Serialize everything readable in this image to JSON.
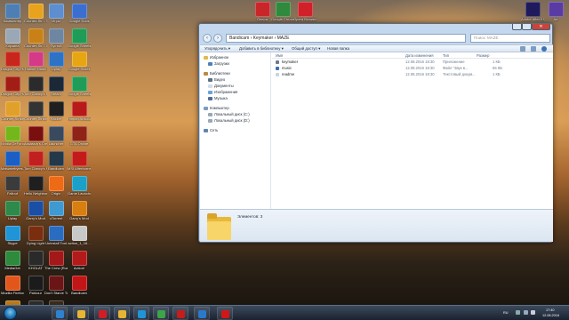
{
  "desktop": {
    "icons": [
      {
        "label": "Компьютер",
        "color": "#4d7fb5"
      },
      {
        "label": "Counter-Str... Source",
        "color": "#e8a21c"
      },
      {
        "label": "Игры",
        "color": "#5c8ed0"
      },
      {
        "label": "Google Docs",
        "color": "#3b6ed1"
      },
      {
        "label": "Корзина",
        "color": "#9aa8b6"
      },
      {
        "label": "Counter-Str... Global Off...",
        "color": "#c98016"
      },
      {
        "label": "Пустой",
        "color": "#6e86a1"
      },
      {
        "label": "Google Sheets",
        "color": "#1f9c57"
      },
      {
        "label": "Dragon City Hack...",
        "color": "#c8261c"
      },
      {
        "label": "Hotline Miami",
        "color": "#d43a86"
      },
      {
        "label": "Uplay",
        "color": "#2d72c5"
      },
      {
        "label": "Google Slides",
        "color": "#e6a511"
      },
      {
        "label": "Dragon City Hack...",
        "color": "#a31d17"
      },
      {
        "label": "Tom Clancy's Ra...",
        "color": "#2b2b2b"
      },
      {
        "label": "Steam",
        "color": "#1b2838"
      },
      {
        "label": "Google Sheets",
        "color": "#1f9c57"
      },
      {
        "label": "Counter-Strike",
        "color": "#e0a02a"
      },
      {
        "label": "Counter-Strike",
        "color": "#333333"
      },
      {
        "label": "Hacker",
        "color": "#1f1f1f"
      },
      {
        "label": "Hitman Absolution",
        "color": "#b81919"
      },
      {
        "label": "Nvidia GeForce Experience",
        "color": "#74b71b"
      },
      {
        "label": "Assassin's Creed",
        "color": "#7a0f0f"
      },
      {
        "label": "Launcher",
        "color": "#394a5e"
      },
      {
        "label": "GTA Online",
        "color": "#8f2318"
      },
      {
        "label": "Malwarebytes Anti-Malware",
        "color": "#1b5fc4"
      },
      {
        "label": "Tom Clancy's Ra...",
        "color": "#c21f1f"
      },
      {
        "label": "Bandicam",
        "color": "#233848"
      },
      {
        "label": "MSI Afterburner",
        "color": "#c41a1a"
      },
      {
        "label": "Fallout",
        "color": "#3b3b3b"
      },
      {
        "label": "Hello Neighbor",
        "color": "#1f1f1f"
      },
      {
        "label": "Origin",
        "color": "#ee6a15"
      },
      {
        "label": "Game Launcher",
        "color": "#1aa0c9"
      },
      {
        "label": "Uplay",
        "color": "#2d8a4a"
      },
      {
        "label": "Garry's Mod",
        "color": "#1b4fa6"
      },
      {
        "label": "uTorrent",
        "color": "#3f9ad1"
      },
      {
        "label": "Garry's Mod",
        "color": "#d87f12"
      },
      {
        "label": "Skype",
        "color": "#1f94d6"
      },
      {
        "label": "Dying Light",
        "color": "#7a2e0f"
      },
      {
        "label": "Uninstall Tool",
        "color": "#2a6cc0"
      },
      {
        "label": "action_1_16...",
        "color": "#c8c8c8"
      },
      {
        "label": "MediaGet",
        "color": "#2e8a3c"
      },
      {
        "label": "KHOLAT",
        "color": "#2a2a2a"
      },
      {
        "label": "The Crew (Russian)",
        "color": "#a31818"
      },
      {
        "label": "Action!",
        "color": "#b31b1b"
      },
      {
        "label": "Mozilla Firefox",
        "color": "#e2561c"
      },
      {
        "label": "Parkour",
        "color": "#1b1b1b"
      },
      {
        "label": "Don't Starve Together",
        "color": "#6a1616"
      },
      {
        "label": "Bandicam",
        "color": "#c21515"
      },
      {
        "label": "Counter-Str... Global Off...",
        "color": "#b97716"
      },
      {
        "label": "Counter-Str... 1.6",
        "color": "#2c2c2c"
      },
      {
        "label": "Don't Starve Together",
        "color": "#3a2a1a"
      }
    ],
    "top_icons": [
      {
        "label": "Опера",
        "color": "#c9262a"
      },
      {
        "label": "Google Chrome",
        "color": "#2f8a3e"
      },
      {
        "label": "Opera Browser",
        "color": "#d0202a"
      },
      {
        "label": "Adobe After Effects",
        "color": "#1e1a5c"
      },
      {
        "label": "Ae",
        "color": "#5a3aa3"
      }
    ]
  },
  "window": {
    "address": "Bandicam › Keymaker › MAZE",
    "search_placeholder": "Поиск: MAZE",
    "toolbar": {
      "organize": "Упорядочить ▾",
      "add_to_library": "Добавить в библиотеку ▾",
      "share": "Общий доступ ▾",
      "new_folder": "Новая папка"
    },
    "nav": {
      "favorites": "Избранное",
      "downloads": "Загрузки",
      "libraries": "Библиотеки",
      "video": "Видео",
      "documents": "Документы",
      "images": "Изображения",
      "music": "Музыка",
      "computer": "Компьютер",
      "local_c": "Локальный диск (C:)",
      "local_d": "Локальный диск (D:)",
      "network": "Сеть"
    },
    "columns": {
      "name": "Имя",
      "date": "Дата изменения",
      "type": "Тип",
      "size": "Размер"
    },
    "files": [
      {
        "name": "keymaker",
        "date": "12.08.2016 18:30",
        "type": "Приложение",
        "size": "1 КБ",
        "color": "#6c7a8b"
      },
      {
        "name": "music",
        "date": "12.08.2016 18:30",
        "type": "Файл \"Звук в...",
        "size": "55 КБ",
        "color": "#3a6fb3"
      },
      {
        "name": "readme",
        "date": "12.08.2016 18:30",
        "type": "Текстовый докум...",
        "size": "1 КБ",
        "color": "#c9d4e0"
      }
    ],
    "details": {
      "count": "Элементов: 3"
    }
  },
  "taskbar": {
    "apps": [
      {
        "name": "windows-media-icon",
        "color": "#2e82d0"
      },
      {
        "name": "folder-icon",
        "color": "#e6b533"
      },
      {
        "name": "opera-icon",
        "color": "#d41c27"
      },
      {
        "name": "explorer-icon",
        "color": "#e6b533"
      },
      {
        "name": "skype-icon",
        "color": "#1f94d6"
      },
      {
        "name": "utorrent-icon",
        "color": "#3ea34b"
      },
      {
        "name": "bandicam-icon",
        "color": "#c71c1c"
      },
      {
        "name": "media-icon",
        "color": "#2b79c9"
      },
      {
        "name": "record-icon",
        "color": "#d01818"
      }
    ],
    "lang": "RU",
    "time": "17:40",
    "date": "12.08.2016"
  }
}
